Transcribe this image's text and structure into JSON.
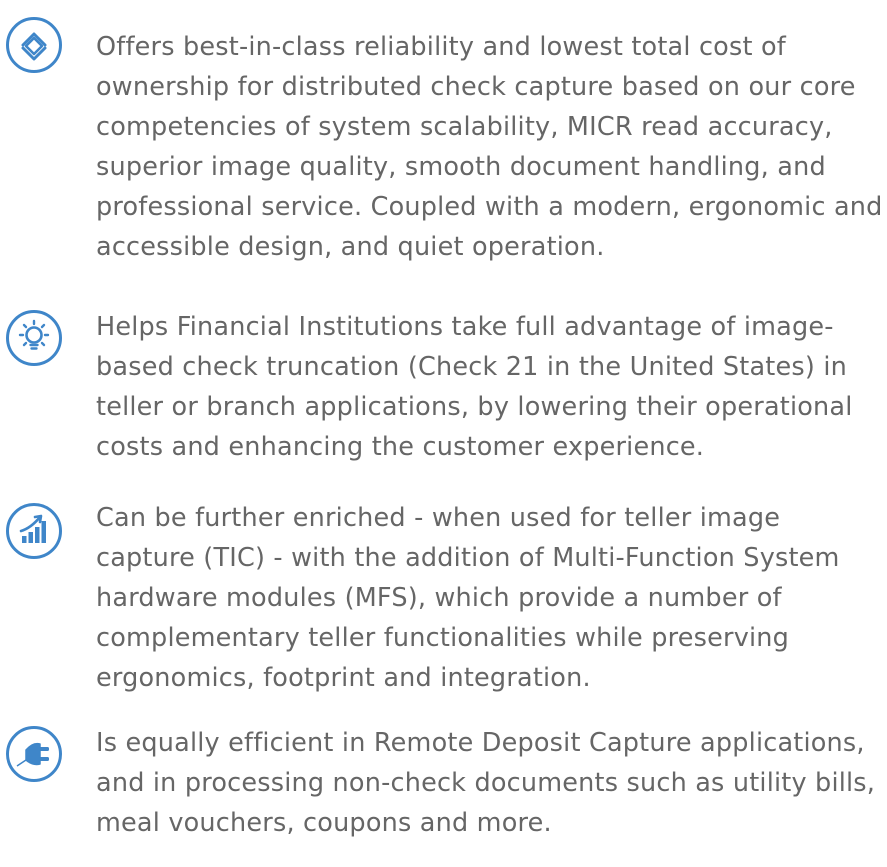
{
  "features": [
    {
      "icon": "layers-icon",
      "text": "Offers best-in-class reliability and lowest total cost of\nownership for distributed check capture based on our core\ncompetencies of system scalability, MICR read accuracy,\nsuperior image quality, smooth document handling, and\nprofessional service. Coupled with a modern, ergonomic and\naccessible design, and quiet operation."
    },
    {
      "icon": "lightbulb-icon",
      "text": "Helps Financial Institutions take full advantage of image-\nbased check truncation (Check 21 in the United States) in\nteller or branch applications, by lowering their operational\ncosts and enhancing the customer experience."
    },
    {
      "icon": "growth-chart-icon",
      "text": "Can be further enriched - when used for teller image\ncapture (TIC) - with the addition of Multi-Function System\nhardware modules (MFS), which provide a number of\ncomplementary teller functionalities while preserving\nergonomics, footprint and integration."
    },
    {
      "icon": "plug-icon",
      "text": "Is equally efficient in Remote Deposit Capture applications,\nand in processing non-check documents such as utility bills,\nmeal vouchers, coupons and more."
    }
  ],
  "colors": {
    "icon_accent": "#3f86c9",
    "text": "#666666"
  }
}
